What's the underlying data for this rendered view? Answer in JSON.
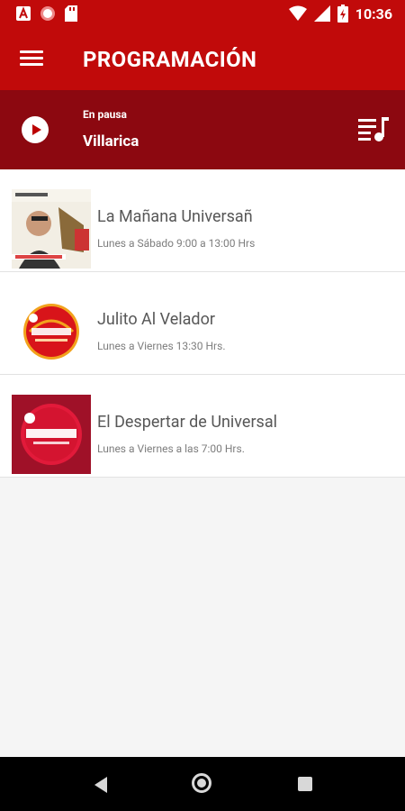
{
  "status_bar": {
    "time": "10:36"
  },
  "app_bar": {
    "title": "PROGRAMACIÓN"
  },
  "player": {
    "status": "En pausa",
    "station": "Villarica"
  },
  "programs": [
    {
      "title": "La Mañana Universañ",
      "schedule": "Lunes a Sábado 9:00 a 13:00 Hrs"
    },
    {
      "title": "Julito Al Velador",
      "schedule": "Lunes a Viernes 13:30 Hrs."
    },
    {
      "title": "El Despertar de Universal",
      "schedule": "Lunes a Viernes a las 7:00 Hrs."
    }
  ],
  "colors": {
    "primary": "#c10a0a",
    "player_bg": "#8c0810"
  }
}
